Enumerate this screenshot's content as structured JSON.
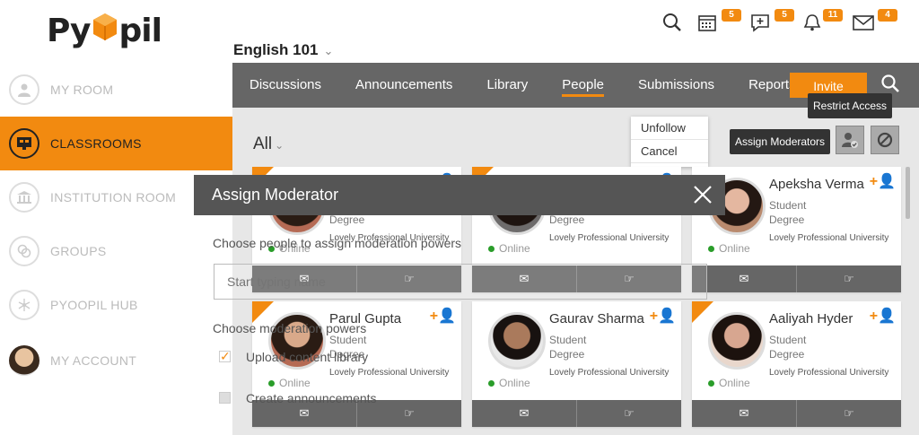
{
  "app": {
    "logo_prefix": "Py",
    "logo_suffix": "pil",
    "course_title": "English 101"
  },
  "topbar": {
    "badges": {
      "calendar": "5",
      "messages_add": "5",
      "notifications": "11",
      "mail": "4"
    }
  },
  "sidebar": {
    "items": [
      {
        "label": "MY ROOM",
        "icon": "user-icon"
      },
      {
        "label": "CLASSROOMS",
        "icon": "classroom-icon"
      },
      {
        "label": "INSTITUTION ROOM",
        "icon": "institution-icon"
      },
      {
        "label": "GROUPS",
        "icon": "groups-icon"
      },
      {
        "label": "PYOOPIL HUB",
        "icon": "hub-icon"
      },
      {
        "label": "MY ACCOUNT",
        "icon": "avatar"
      }
    ]
  },
  "nav": {
    "tabs": [
      "Discussions",
      "Announcements",
      "Library",
      "People",
      "Submissions",
      "Reports"
    ],
    "invite_label": "Invite"
  },
  "content": {
    "filter_label": "All",
    "dropdown": [
      "Unfollow",
      "Cancel"
    ],
    "tooltip_restrict": "Restrict Access",
    "tooltip_assign": "Assign Moderators"
  },
  "people": [
    {
      "name": "",
      "role": "",
      "degree": "Degree",
      "university": "Lovely Professional University",
      "status": "Online"
    },
    {
      "name": "",
      "role": "",
      "degree": "Degree",
      "university": "Lovely Professional University",
      "status": "Online"
    },
    {
      "name": "Apeksha Verma",
      "role": "Student",
      "degree": "Degree",
      "university": "Lovely Professional University",
      "status": "Online"
    },
    {
      "name": "Parul Gupta",
      "role": "Student",
      "degree": "Degree",
      "university": "Lovely Professional University",
      "status": "Online"
    },
    {
      "name": "Gaurav Sharma",
      "role": "Student",
      "degree": "Degree",
      "university": "Lovely Professional University",
      "status": "Online"
    },
    {
      "name": "Aaliyah Hyder",
      "role": "Student",
      "degree": "Degree",
      "university": "Lovely Professional University",
      "status": "Online"
    }
  ],
  "modal": {
    "title": "Assign Moderator",
    "choose_people": "Choose people to assign moderation powers",
    "input_placeholder": "Start typing name",
    "choose_powers": "Choose moderation powers",
    "powers": [
      "Upload content library",
      "Create announcements"
    ]
  },
  "colors": {
    "accent": "#f28a10",
    "nav_bg": "#666666",
    "content_bg": "#e7e7e7"
  }
}
